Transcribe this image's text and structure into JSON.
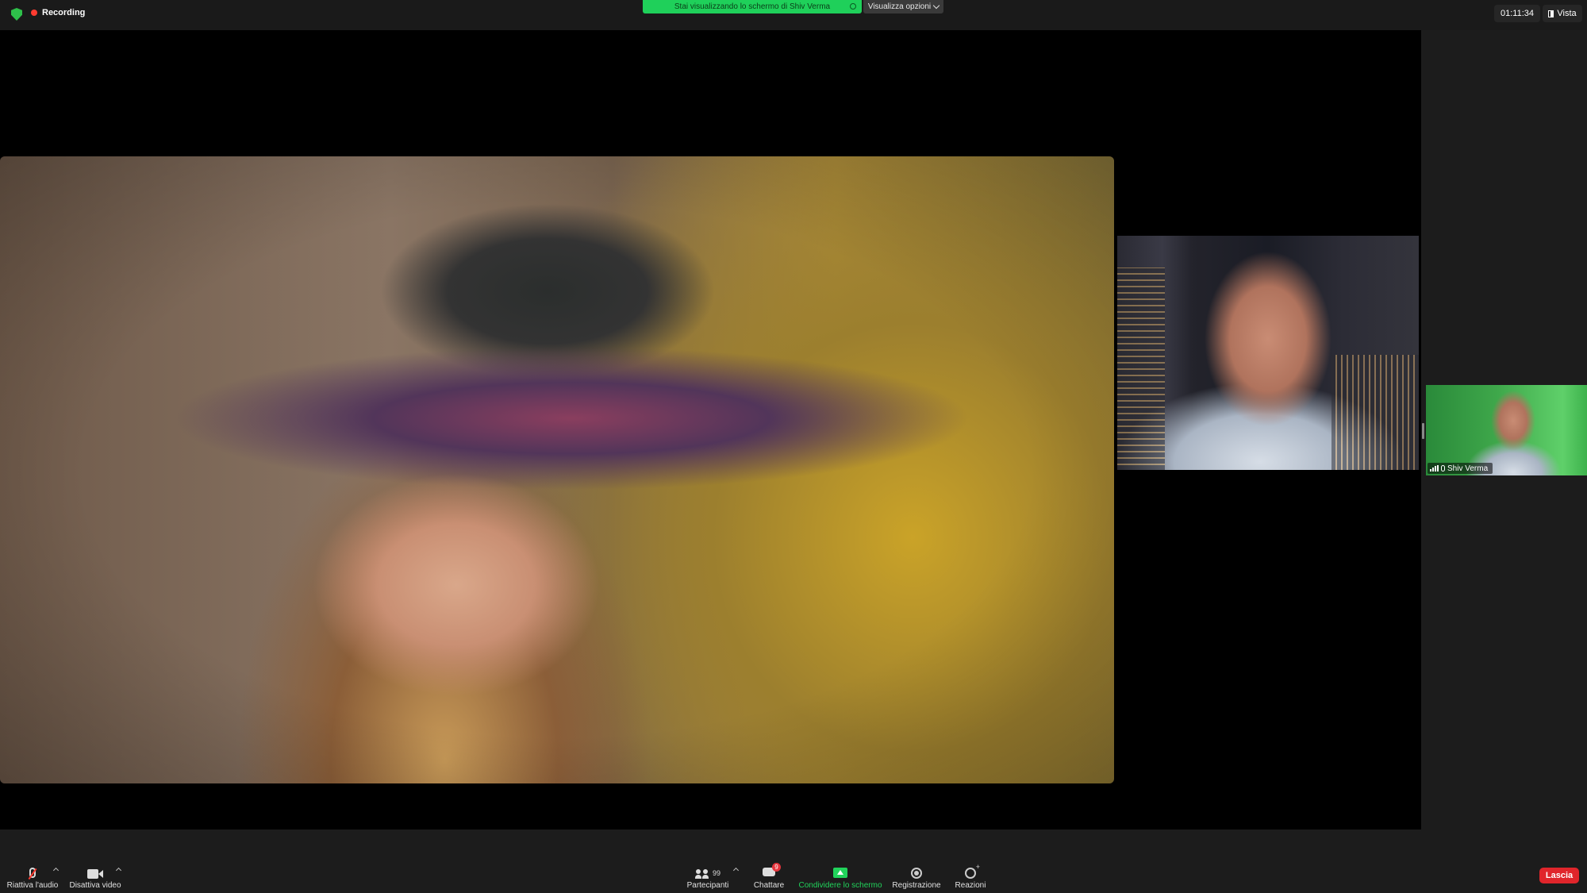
{
  "topbar": {
    "recording_label": "Recording",
    "share_banner": "Stai visualizzando lo schermo di Shiv Verma",
    "view_options": "Visualizza opzioni",
    "timer": "01:11:34",
    "view_label": "Vista"
  },
  "participants": {
    "self_name": "Shiv Verma"
  },
  "toolbar": {
    "unmute_label": "Riattiva l'audio",
    "video_label": "Disattiva video",
    "participants_label": "Partecipanti",
    "participants_count": "99",
    "chat_label": "Chattare",
    "chat_badge": "9",
    "share_label": "Condividere lo schermo",
    "record_label": "Registrazione",
    "reactions_label": "Reazioni",
    "leave_label": "Lascia"
  },
  "colors": {
    "accent_green": "#21d35b",
    "leave_red": "#e0252b",
    "recording_red": "#ff3b30"
  }
}
